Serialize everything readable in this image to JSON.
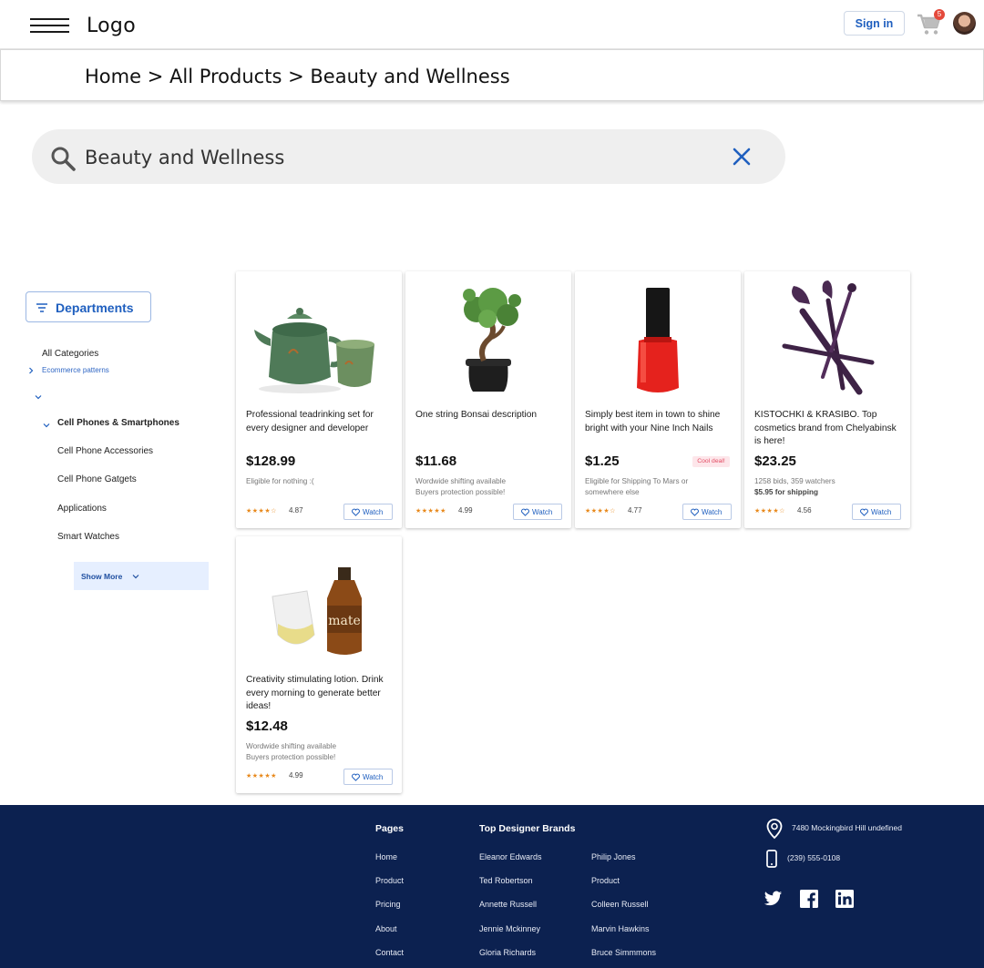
{
  "header": {
    "logo": "Logo",
    "sign_in": "Sign in",
    "cart_count": "5"
  },
  "breadcrumb": {
    "items": [
      "Home",
      "All Products",
      "Beauty and Wellness"
    ],
    "separator": ">"
  },
  "search": {
    "value": "Beauty and Wellness"
  },
  "sidebar": {
    "departments_label": "Departments",
    "all_categories": "All Categories",
    "ecommerce_patterns": "Ecommerce patterns",
    "category": "Cell Phones & Smartphones",
    "subcategories": [
      "Cell Phone Accessories",
      "Cell Phone Gatgets",
      "Applications",
      "Smart Watches"
    ],
    "show_more": "Show More"
  },
  "products": [
    {
      "title": "Professional teadrinking set for every designer and developer",
      "price": "$128.99",
      "shipping_line1": "Eligible for nothing :(",
      "shipping_line2": "",
      "rating": "4.87",
      "watch": "Watch",
      "image": "teapot-image"
    },
    {
      "title": "One string Bonsai description",
      "price": "$11.68",
      "shipping_line1": "Wordwide shifting available",
      "shipping_line2": "Buyers protection possible!",
      "rating": "4.99",
      "watch": "Watch",
      "image": "bonsai-image"
    },
    {
      "title": "Simply best item in town to shine bright with your Nine Inch Nails",
      "price": "$1.25",
      "badge": "Cool deal!",
      "shipping_line1": "Eligible for Shipping To Mars or",
      "shipping_line2": "somewhere else",
      "rating": "4.77",
      "watch": "Watch",
      "image": "nail-polish-image"
    },
    {
      "title": "KISTOCHKI & KRASIBO. Top cosmetics brand from Chelyabinsk is here!",
      "price": "$23.25",
      "shipping_line1": "1258 bids, 359 watchers",
      "shipping_line2": "$5.95 for shipping",
      "rating": "4.56",
      "watch": "Watch",
      "image": "makeup-brushes-image"
    },
    {
      "title": "Creativity stimulating lotion. Drink every morning to generate better ideas!",
      "price": "$12.48",
      "shipping_line1": "Wordwide shifting available",
      "shipping_line2": "Buyers protection possible!",
      "rating": "4.99",
      "watch": "Watch",
      "image": "mate-bottle-image"
    }
  ],
  "footer": {
    "pages_heading": "Pages",
    "pages": [
      "Home",
      "Product",
      "Pricing",
      "About",
      "Contact"
    ],
    "brands_heading": "Top  Designer Brands",
    "brands_col1": [
      "Eleanor Edwards",
      "Ted Robertson",
      "Annette Russell",
      "Jennie Mckinney",
      "Gloria Richards"
    ],
    "brands_col2": [
      "Philip Jones",
      "Product",
      "Colleen Russell",
      "Marvin Hawkins",
      "Bruce Simmmons"
    ],
    "address": "7480 Mockingbird Hill undefined",
    "phone": "(239) 555-0108"
  },
  "colors": {
    "accent": "#1f5fbf",
    "footer_bg": "#0c2150",
    "star": "#e8891c",
    "badge": "#e4493b"
  }
}
